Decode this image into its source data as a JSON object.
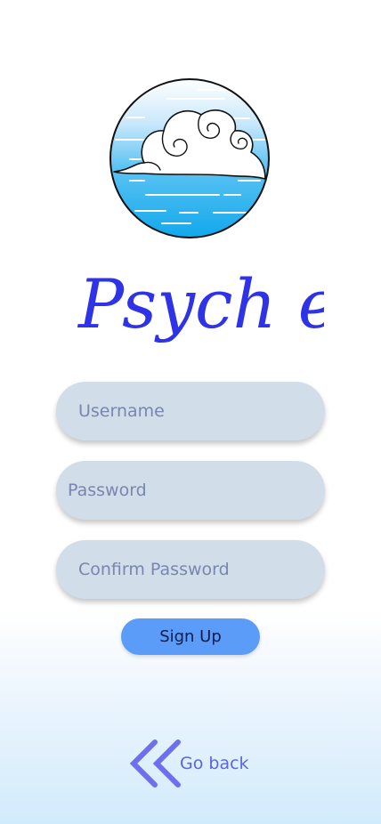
{
  "brand": {
    "logo_icon": "cloud-logo-icon",
    "name": "Psych e"
  },
  "form": {
    "username_placeholder": "Username",
    "password_placeholder": "Password",
    "confirm_password_placeholder": "Confirm Password",
    "signup_label": "Sign Up"
  },
  "navigation": {
    "back_icon": "double-chevron-left-icon",
    "back_label": "Go back"
  },
  "colors": {
    "brand_text": "#2f33e8",
    "field_background": "#d1dde9",
    "button_background": "#5b9cf8",
    "back_link": "#5a64e8"
  }
}
